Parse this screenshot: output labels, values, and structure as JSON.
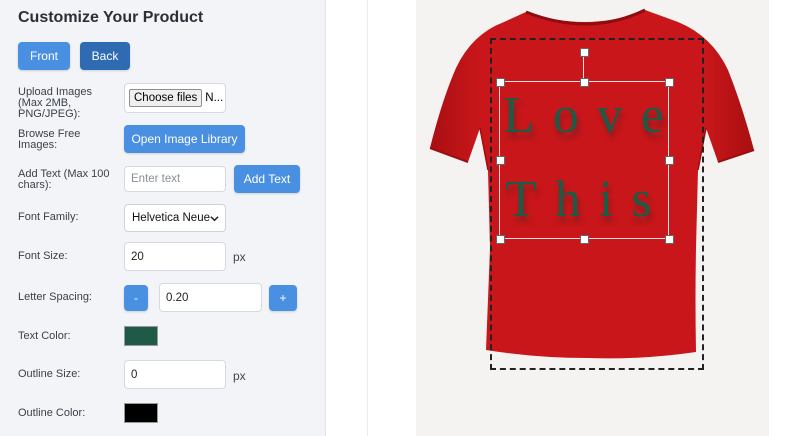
{
  "panel": {
    "title": "Customize Your Product",
    "view_buttons": {
      "front": "Front",
      "back": "Back"
    },
    "upload": {
      "label": "Upload Images (Max 2MB, PNG/JPEG):",
      "button": "Choose files",
      "file_status": "N..."
    },
    "library": {
      "label": "Browse Free Images:",
      "button": "Open Image Library"
    },
    "add_text": {
      "label": "Add Text (Max 100 chars):",
      "placeholder": "Enter text",
      "button": "Add Text"
    },
    "font_family": {
      "label": "Font Family:",
      "value": "Helvetica Neue"
    },
    "font_size": {
      "label": "Font Size:",
      "value": "20",
      "unit": "px"
    },
    "letter_spacing": {
      "label": "Letter Spacing:",
      "minus": "-",
      "value": "0.20",
      "plus": "+"
    },
    "text_color": {
      "label": "Text Color:",
      "color": "#1f5a46"
    },
    "outline_size": {
      "label": "Outline Size:",
      "value": "0",
      "unit": "px"
    },
    "outline_color": {
      "label": "Outline Color:",
      "color": "#000000"
    }
  },
  "design": {
    "lines": [
      "Love",
      "This"
    ],
    "text_color": "#1f5a46",
    "shirt_color": "#c8161a"
  },
  "colors": {
    "accent": "#4a90e2",
    "accent_dark": "#2f6bb3"
  }
}
